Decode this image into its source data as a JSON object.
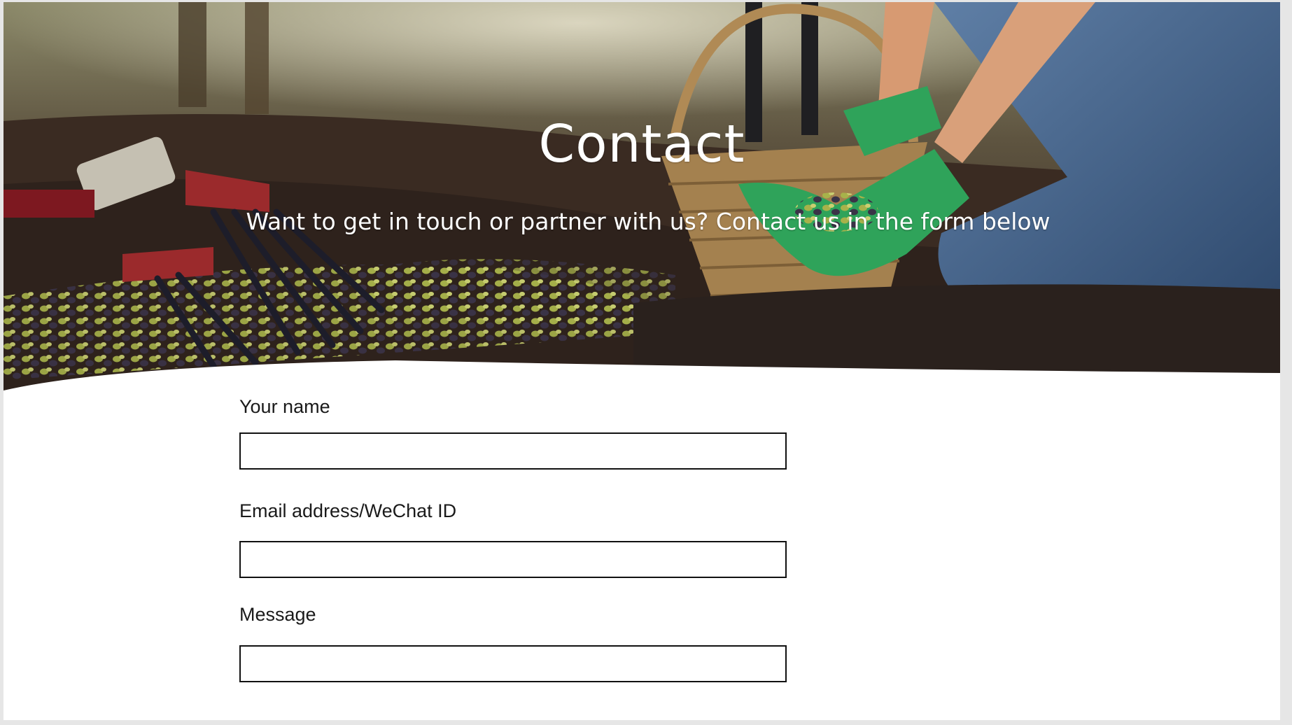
{
  "hero": {
    "title": "Contact",
    "subtitle": "Want to get in touch or partner with us? Contact us in the form below"
  },
  "form": {
    "fields": [
      {
        "label": "Your name",
        "value": "",
        "placeholder": ""
      },
      {
        "label": "Email address/WeChat ID",
        "value": "",
        "placeholder": ""
      },
      {
        "label": "Message",
        "value": "",
        "placeholder": ""
      }
    ]
  },
  "colors": {
    "title_text": "#ffffff",
    "label_text": "#1a1a1a",
    "input_border": "#111111",
    "glove_green": "#2fa35a",
    "soil_brown": "#3b2a22"
  }
}
